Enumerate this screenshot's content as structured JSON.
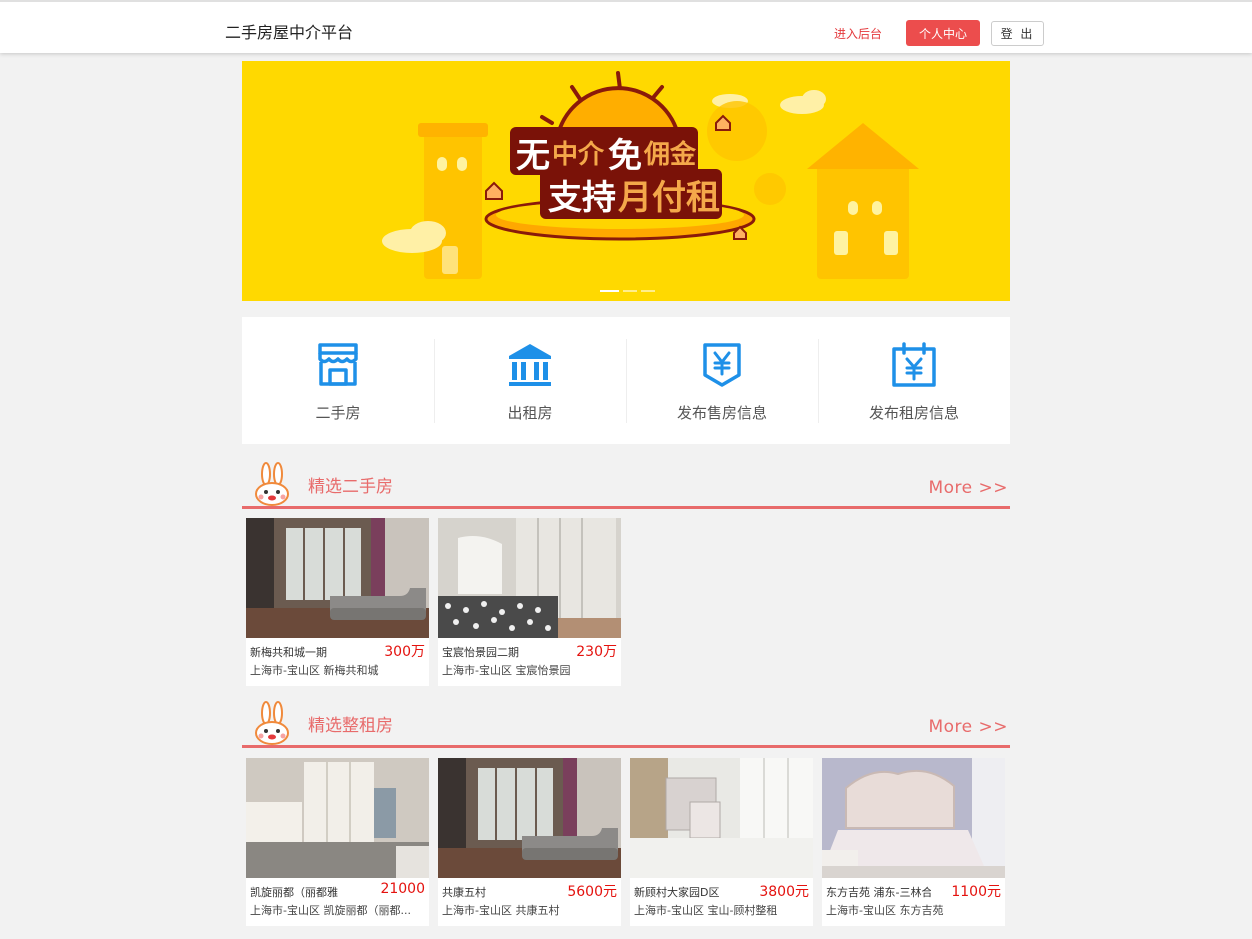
{
  "header": {
    "brand": "二手房屋中介平台",
    "admin_link": "进入后台",
    "center_button": "个人中心",
    "logout_button": "登 出"
  },
  "banner": {
    "line1_a": "无",
    "line1_b": "中介",
    "line1_c": "免",
    "line1_d": "佣金",
    "line2_a": "支持",
    "line2_b": "月付租",
    "slide_count": 3,
    "active_slide": 1,
    "colors": {
      "bg": "#ffd900",
      "text_dark": "#7a1208",
      "text_accent": "#f4a84a"
    }
  },
  "quicknav": [
    {
      "label": "二手房",
      "icon": "storefront-icon"
    },
    {
      "label": "出租房",
      "icon": "bank-building-icon"
    },
    {
      "label": "发布售房信息",
      "icon": "yen-shield-icon"
    },
    {
      "label": "发布租房信息",
      "icon": "yen-calendar-icon"
    }
  ],
  "sections": {
    "secondhand": {
      "title": "精选二手房",
      "more": "More >>",
      "items": [
        {
          "name": "新梅共和城一期",
          "price": "300万",
          "addr": "上海市-宝山区 新梅共和城",
          "photo": "living-room-photo"
        },
        {
          "name": "宝宸怡景园二期",
          "price": "230万",
          "addr": "上海市-宝山区 宝宸怡景园",
          "photo": "bedroom-photo"
        }
      ]
    },
    "rental": {
      "title": "精选整租房",
      "more": "More >>",
      "items": [
        {
          "name": "凯旋丽都（丽都雅",
          "price": "21000",
          "addr": "上海市-宝山区 凯旋丽都（丽都...",
          "photo": "wardrobe-bedroom-photo"
        },
        {
          "name": "共康五村",
          "price": "5600元",
          "addr": "上海市-宝山区 共康五村",
          "photo": "living-room-photo"
        },
        {
          "name": "新顾村大家园D区",
          "price": "3800元",
          "addr": "上海市-宝山区 宝山-顾村整租",
          "photo": "empty-room-photo"
        },
        {
          "name": "东方吉苑 浦东-三林合",
          "price": "1100元",
          "addr": "上海市-宝山区 东方吉苑",
          "photo": "bed-photo"
        }
      ]
    }
  },
  "colors": {
    "accent": "#e86b6b",
    "price": "#e4120e",
    "icon": "#1e90e8",
    "button": "#ec4d4d"
  }
}
